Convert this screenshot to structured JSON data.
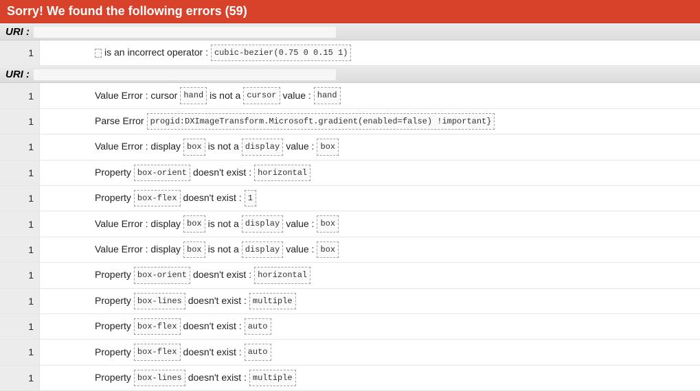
{
  "banner": {
    "title": "Sorry! We found the following errors (59)"
  },
  "labels": {
    "uri": "URI :",
    "is_incorrect_operator": "is an incorrect operator :",
    "value_error": "Value Error :",
    "is_not_a": "is not a",
    "value_colon": "value :",
    "parse_error": "Parse Error",
    "property": "Property",
    "doesnt_exist": "doesn't exist :"
  },
  "sections": [
    {
      "uri_redacted": true,
      "rows": [
        {
          "line": "1",
          "type": "incorrect_operator",
          "code1": "cubic-bezier(0.75 0 0.15 1)"
        }
      ]
    },
    {
      "uri_redacted": true,
      "rows": [
        {
          "line": "1",
          "type": "value_error",
          "prop": "cursor",
          "chip1": "hand",
          "chip2": "cursor",
          "chip3": "hand"
        },
        {
          "line": "1",
          "type": "parse_error",
          "code1": "progid:DXImageTransform.Microsoft.gradient(enabled=false) !important}"
        },
        {
          "line": "1",
          "type": "value_error",
          "prop": "display",
          "chip1": "box",
          "chip2": "display",
          "chip3": "box"
        },
        {
          "line": "1",
          "type": "property_missing",
          "chip1": "box-orient",
          "chip3": "horizontal"
        },
        {
          "line": "1",
          "type": "property_missing",
          "chip1": "box-flex",
          "chip3": "1"
        },
        {
          "line": "1",
          "type": "value_error",
          "prop": "display",
          "chip1": "box",
          "chip2": "display",
          "chip3": "box"
        },
        {
          "line": "1",
          "type": "value_error",
          "prop": "display",
          "chip1": "box",
          "chip2": "display",
          "chip3": "box"
        },
        {
          "line": "1",
          "type": "property_missing",
          "chip1": "box-orient",
          "chip3": "horizontal"
        },
        {
          "line": "1",
          "type": "property_missing",
          "chip1": "box-lines",
          "chip3": "multiple"
        },
        {
          "line": "1",
          "type": "property_missing",
          "chip1": "box-flex",
          "chip3": "auto"
        },
        {
          "line": "1",
          "type": "property_missing",
          "chip1": "box-flex",
          "chip3": "auto"
        },
        {
          "line": "1",
          "type": "property_missing",
          "chip1": "box-lines",
          "chip3": "multiple"
        }
      ]
    }
  ]
}
